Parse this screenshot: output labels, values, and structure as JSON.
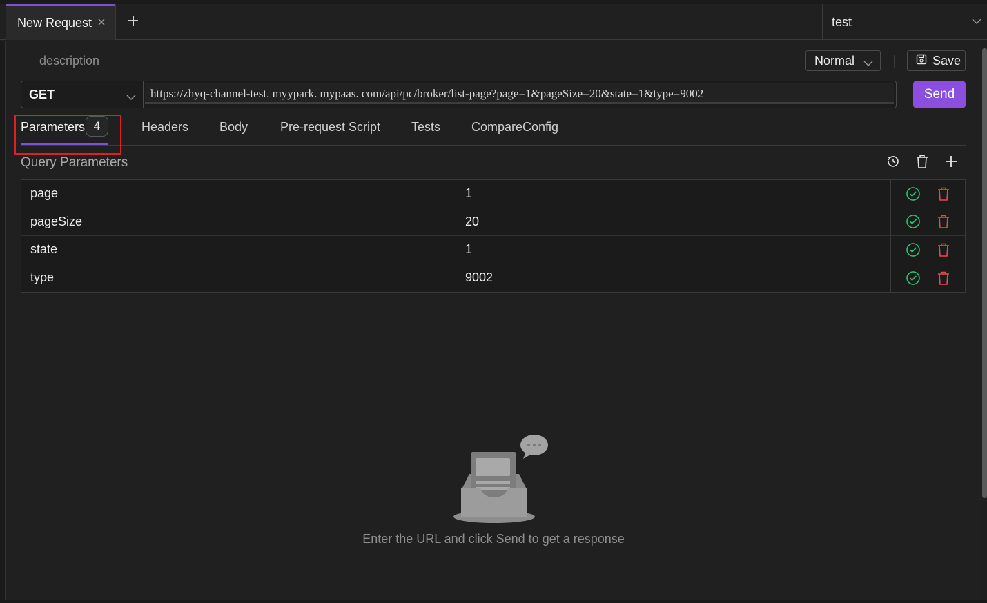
{
  "tabs": [
    {
      "label": "New Request"
    }
  ],
  "environment": {
    "label": "test"
  },
  "request": {
    "description_placeholder": "description",
    "mode": "Normal",
    "save_label": "Save",
    "method": "GET",
    "url": "https://zhyq-channel-test. myypark. mypaas. com/api/pc/broker/list-page?page=1&pageSize=20&state=1&type=9002",
    "send_label": "Send"
  },
  "request_tabs": [
    {
      "label": "Parameters",
      "count": "4"
    },
    {
      "label": "Headers"
    },
    {
      "label": "Body"
    },
    {
      "label": "Pre-request Script"
    },
    {
      "label": "Tests"
    },
    {
      "label": "CompareConfig"
    }
  ],
  "query_params": {
    "title": "Query Parameters",
    "rows": [
      {
        "key": "page",
        "value": "1"
      },
      {
        "key": "pageSize",
        "value": "20"
      },
      {
        "key": "state",
        "value": "1"
      },
      {
        "key": "type",
        "value": "9002"
      }
    ]
  },
  "response": {
    "empty_message": "Enter the URL and click Send to get a response"
  },
  "colors": {
    "accent": "#8b4fe0",
    "enabled": "#2fbf71",
    "delete": "#e5484d",
    "highlight": "#e02020"
  },
  "icons": [
    "close-icon",
    "plus-icon",
    "chevron-down-icon",
    "save-icon",
    "history-icon",
    "trash-icon",
    "check-circle-icon",
    "empty-inbox-icon"
  ]
}
